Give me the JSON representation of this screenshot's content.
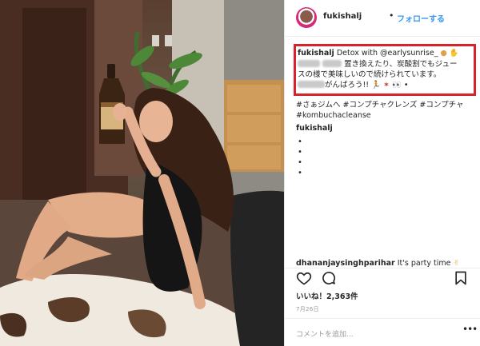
{
  "post": {
    "username": "fukishalj",
    "follow_label": "フォローする",
    "dot": "•",
    "caption": {
      "line1_text": " Detox with @earlysunrise_ ",
      "line2_text": "置き換えたり、炭酸割でもジュー",
      "line3_text": "スの様で美味しいので続けられています。",
      "line4_text": "がんばろう!! "
    },
    "hashtags": [
      "#さぁジムへ #コンプチャクレンズ #コンプチャ",
      "#kombuchacleanse"
    ],
    "comment1_user": "fukishalj",
    "dots": [
      "•",
      "•",
      "•",
      "•"
    ],
    "comment2_user": "dhananjaysinghparihar",
    "comment2_text": " It's party time ",
    "likes": "いいね！2,363件",
    "date": "7月26日",
    "comment_placeholder": "コメントを追加..."
  },
  "icons": {
    "like": "heart-icon",
    "comment": "comment-bubble-icon",
    "save": "bookmark-icon",
    "more": "more-dots-icon"
  },
  "colors": {
    "follow": "#3897f0",
    "highlight_box": "#d8232a"
  }
}
